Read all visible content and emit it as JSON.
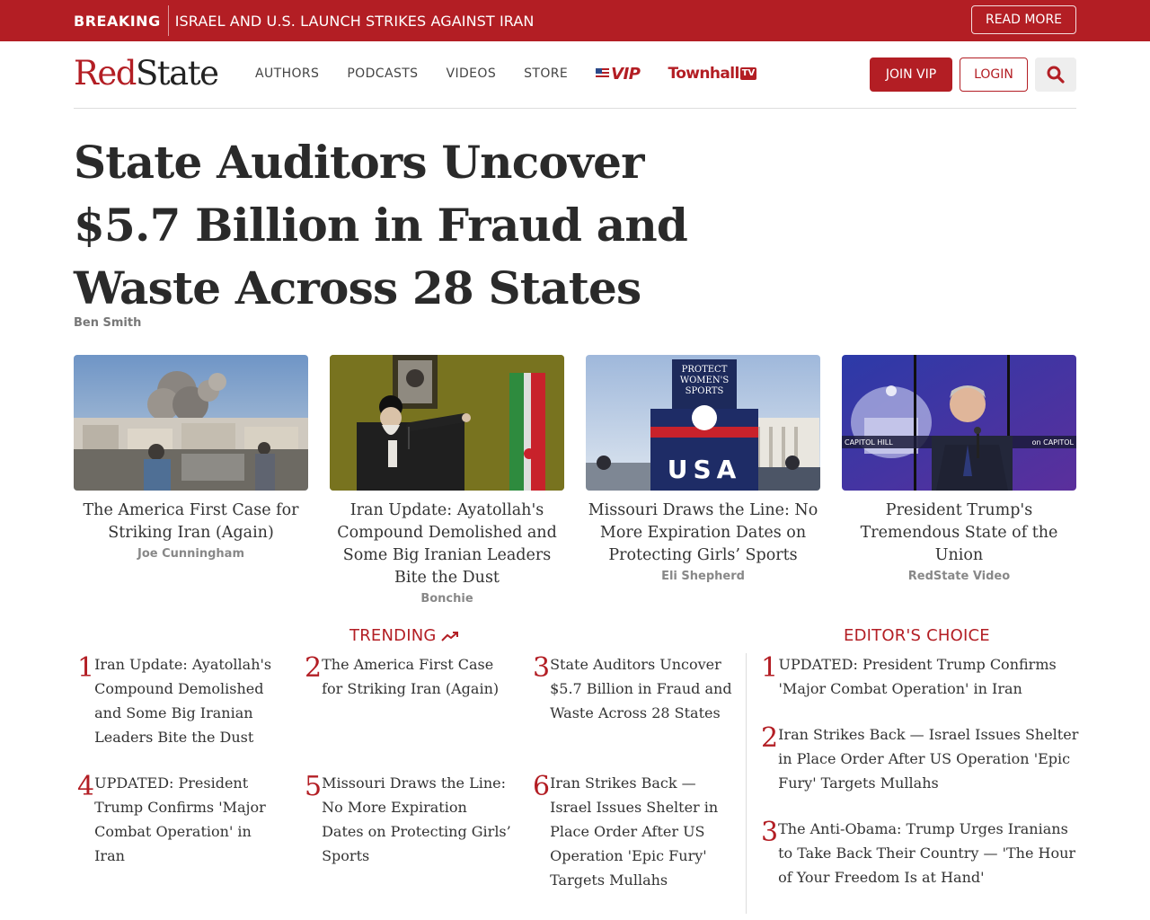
{
  "breaking": {
    "label": "BREAKING",
    "text": "ISRAEL AND U.S. LAUNCH STRIKES AGAINST IRAN",
    "read_more": "READ MORE"
  },
  "nav": {
    "logo_red": "Red",
    "logo_black": "State",
    "links": [
      "AUTHORS",
      "PODCASTS",
      "VIDEOS",
      "STORE"
    ],
    "vip": "VIP",
    "townhall": "Townhall",
    "townhall_tv": "TV",
    "join": "JOIN VIP",
    "login": "LOGIN"
  },
  "headline": {
    "title": "State Auditors Uncover $5.7 Billion in Fraud and Waste Across 28 States",
    "author": "Ben Smith"
  },
  "cards": [
    {
      "title": "The America First Case for Striking Iran (Again)",
      "author": "Joe Cunningham"
    },
    {
      "title": "Iran Update: Ayatollah's Compound Demolished and Some Big Iranian Leaders Bite the Dust",
      "author": "Bonchie"
    },
    {
      "title": "Missouri Draws the Line: No More Expiration Dates on Protecting Girls’ Sports",
      "author": "Eli Shepherd",
      "sign_text": "PROTECT WOMEN'S SPORTS",
      "jacket_text": "USA"
    },
    {
      "title": "President Trump's Tremendous State of the Union",
      "author": "RedState Video",
      "lower_third": "CAPITOL HILL",
      "lower_third_right": "on CAPITOL"
    }
  ],
  "trending": {
    "heading": "TRENDING",
    "items": [
      {
        "num": "1",
        "text": "Iran Update: Ayatollah's Compound Demolished and Some Big Iranian Leaders Bite the Dust"
      },
      {
        "num": "2",
        "text": "The America First Case for Striking Iran (Again)"
      },
      {
        "num": "3",
        "text": "State Auditors Uncover $5.7 Billion in Fraud and Waste Across 28 States"
      },
      {
        "num": "4",
        "text": "UPDATED: President Trump Confirms 'Major Combat Operation' in Iran"
      },
      {
        "num": "5",
        "text": "Missouri Draws the Line: No More Expiration Dates on Protecting Girls’ Sports"
      },
      {
        "num": "6",
        "text": "Iran Strikes Back — Israel Issues Shelter in Place Order After US Operation 'Epic Fury' Targets Mullahs"
      }
    ]
  },
  "editors_choice": {
    "heading": "EDITOR'S CHOICE",
    "items": [
      {
        "num": "1",
        "text": "UPDATED: President Trump Confirms 'Major Combat Operation' in Iran"
      },
      {
        "num": "2",
        "text": "Iran Strikes Back — Israel Issues Shelter in Place Order After US Operation 'Epic Fury' Targets Mullahs"
      },
      {
        "num": "3",
        "text": "The Anti-Obama: Trump Urges Iranians to Take Back Their Country — 'The Hour of Your Freedom Is at Hand'"
      }
    ]
  },
  "colors": {
    "brand_red": "#b31e24",
    "text_dark": "#2a2a2a",
    "muted": "#888888"
  },
  "icons": [
    "search-icon",
    "trending-arrow-icon",
    "flag-icon"
  ]
}
